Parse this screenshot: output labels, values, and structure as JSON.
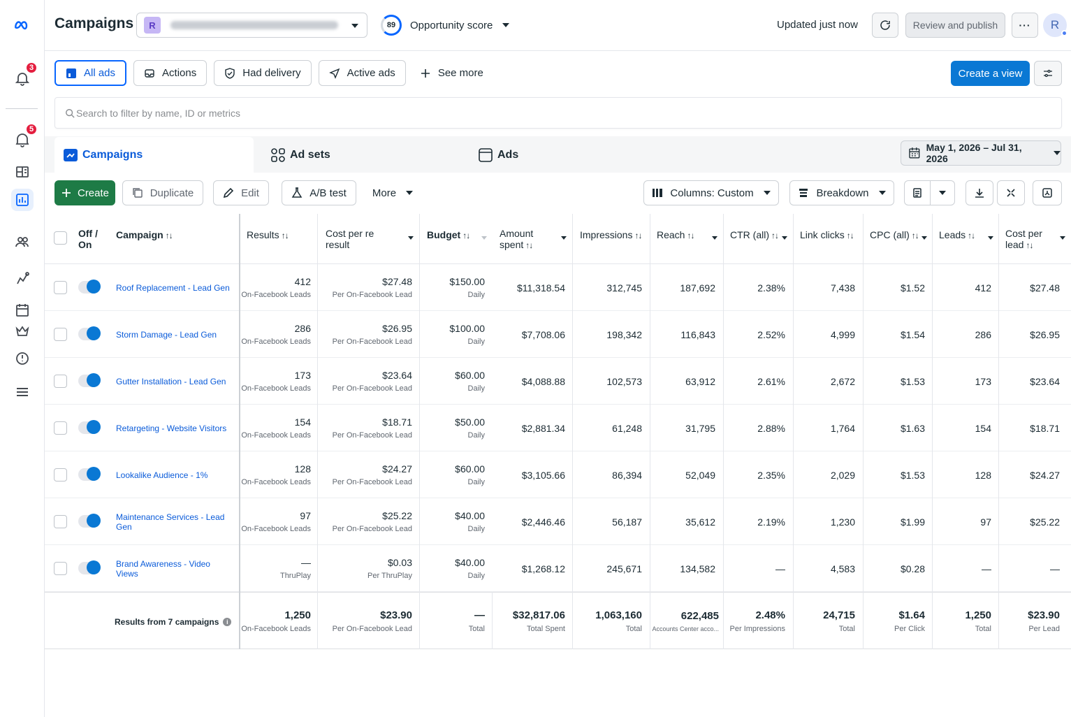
{
  "header": {
    "title": "Campaigns",
    "account_initial": "R",
    "opportunity_score": "89",
    "opportunity_label": "Opportunity score",
    "updated_text": "Updated just now",
    "review_label": "Review and publish",
    "more_label": "···",
    "user_initial": "R"
  },
  "rail": {
    "notifications_badge": "3",
    "alerts_badge": "5"
  },
  "filters": {
    "all_ads": "All ads",
    "actions": "Actions",
    "had_delivery": "Had delivery",
    "active_ads": "Active ads",
    "see_more": "See more",
    "create_view": "Create a view"
  },
  "search": {
    "placeholder": "Search to filter by name, ID or metrics"
  },
  "levels": {
    "campaigns": "Campaigns",
    "ad_sets": "Ad sets",
    "ads": "Ads",
    "date_range": "May 1, 2026 – Jul 31, 2026"
  },
  "toolbar": {
    "create": "Create",
    "duplicate": "Duplicate",
    "edit": "Edit",
    "ab_test": "A/B test",
    "more": "More",
    "columns": "Columns: Custom",
    "breakdown": "Breakdown"
  },
  "table": {
    "headers": {
      "off_on_1": "Off /",
      "off_on_2": "On",
      "campaign": "Campaign",
      "results": "Results",
      "cost_per_result_1": "Cost per re",
      "cost_per_result_2": "result",
      "budget": "Budget",
      "amount_spent_1": "Amount",
      "amount_spent_2": "spent",
      "impressions": "Impressions",
      "reach": "Reach",
      "ctr": "CTR (all)",
      "link_clicks": "Link clicks",
      "cpc": "CPC (all)",
      "leads": "Leads",
      "cost_per_lead_1": "Cost per",
      "cost_per_lead_2": "lead"
    },
    "rows": [
      {
        "name": "Roof Replacement - Lead Gen",
        "results": "412",
        "results_sub": "On-Facebook Leads",
        "cpr": "$27.48",
        "cpr_sub": "Per On-Facebook Lead",
        "budget": "$150.00",
        "budget_sub": "Daily",
        "spent": "$11,318.54",
        "impressions": "312,745",
        "reach": "187,692",
        "ctr": "2.38%",
        "link_clicks": "7,438",
        "cpc": "$1.52",
        "leads": "412",
        "cpl": "$27.48"
      },
      {
        "name": "Storm Damage - Lead Gen",
        "results": "286",
        "results_sub": "On-Facebook Leads",
        "cpr": "$26.95",
        "cpr_sub": "Per On-Facebook Lead",
        "budget": "$100.00",
        "budget_sub": "Daily",
        "spent": "$7,708.06",
        "impressions": "198,342",
        "reach": "116,843",
        "ctr": "2.52%",
        "link_clicks": "4,999",
        "cpc": "$1.54",
        "leads": "286",
        "cpl": "$26.95"
      },
      {
        "name": "Gutter Installation - Lead Gen",
        "results": "173",
        "results_sub": "On-Facebook Leads",
        "cpr": "$23.64",
        "cpr_sub": "Per On-Facebook Lead",
        "budget": "$60.00",
        "budget_sub": "Daily",
        "spent": "$4,088.88",
        "impressions": "102,573",
        "reach": "63,912",
        "ctr": "2.61%",
        "link_clicks": "2,672",
        "cpc": "$1.53",
        "leads": "173",
        "cpl": "$23.64"
      },
      {
        "name": "Retargeting - Website Visitors",
        "results": "154",
        "results_sub": "On-Facebook Leads",
        "cpr": "$18.71",
        "cpr_sub": "Per On-Facebook Lead",
        "budget": "$50.00",
        "budget_sub": "Daily",
        "spent": "$2,881.34",
        "impressions": "61,248",
        "reach": "31,795",
        "ctr": "2.88%",
        "link_clicks": "1,764",
        "cpc": "$1.63",
        "leads": "154",
        "cpl": "$18.71"
      },
      {
        "name": "Lookalike Audience - 1%",
        "results": "128",
        "results_sub": "On-Facebook Leads",
        "cpr": "$24.27",
        "cpr_sub": "Per On-Facebook Lead",
        "budget": "$60.00",
        "budget_sub": "Daily",
        "spent": "$3,105.66",
        "impressions": "86,394",
        "reach": "52,049",
        "ctr": "2.35%",
        "link_clicks": "2,029",
        "cpc": "$1.53",
        "leads": "128",
        "cpl": "$24.27"
      },
      {
        "name": "Maintenance Services - Lead Gen",
        "results": "97",
        "results_sub": "On-Facebook Leads",
        "cpr": "$25.22",
        "cpr_sub": "Per On-Facebook Lead",
        "budget": "$40.00",
        "budget_sub": "Daily",
        "spent": "$2,446.46",
        "impressions": "56,187",
        "reach": "35,612",
        "ctr": "2.19%",
        "link_clicks": "1,230",
        "cpc": "$1.99",
        "leads": "97",
        "cpl": "$25.22"
      },
      {
        "name": "Brand Awareness - Video Views",
        "results": "—",
        "results_sub": "ThruPlay",
        "cpr": "$0.03",
        "cpr_sub": "Per ThruPlay",
        "budget": "$40.00",
        "budget_sub": "Daily",
        "spent": "$1,268.12",
        "impressions": "245,671",
        "reach": "134,582",
        "ctr": "—",
        "link_clicks": "4,583",
        "cpc": "$0.28",
        "leads": "—",
        "cpl": "—"
      }
    ],
    "totals": {
      "label": "Results from 7 campaigns",
      "results": "1,250",
      "results_sub": "On-Facebook Leads",
      "cpr": "$23.90",
      "cpr_sub": "Per On-Facebook Lead",
      "budget": "—",
      "budget_sub": "Total",
      "spent": "$32,817.06",
      "spent_sub": "Total Spent",
      "impressions": "1,063,160",
      "impressions_sub": "Total",
      "reach": "622,485",
      "reach_sub": "Accounts Center acco...",
      "ctr": "2.48%",
      "ctr_sub": "Per Impressions",
      "link_clicks": "24,715",
      "link_clicks_sub": "Total",
      "cpc": "$1.64",
      "cpc_sub": "Per Click",
      "leads": "1,250",
      "leads_sub": "Total",
      "cpl": "$23.90",
      "cpl_sub": "Per Lead"
    }
  },
  "colors": {
    "accent": "#0866ff",
    "primary_button": "#0a78d4",
    "create_button": "#1e7b46",
    "badge": "#e41e3f"
  }
}
